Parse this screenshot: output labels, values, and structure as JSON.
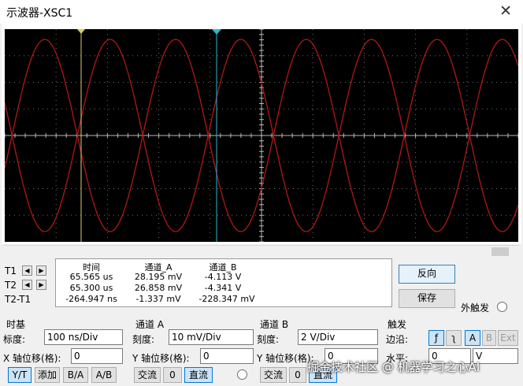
{
  "window": {
    "title": "示波器-XSC1",
    "close_glyph": "✕"
  },
  "cursors": {
    "labels": [
      "T1",
      "T2",
      "T2-T1"
    ],
    "arrow_left": "◆",
    "arrow_right": "◆"
  },
  "readout": {
    "headers": [
      "时间",
      "通道_A",
      "通道_B"
    ],
    "rows": [
      [
        "65.565 us",
        "28.195 mV",
        "-4.113 V"
      ],
      [
        "65.300 us",
        "26.858 mV",
        "-4.341 V"
      ],
      [
        "-264.947 ns",
        "-1.337 mV",
        "-228.347 mV"
      ]
    ]
  },
  "actions": {
    "reverse": "反向",
    "save": "保存",
    "ext_trigger": "外触发"
  },
  "timebase": {
    "title": "时基",
    "scale_label": "标度:",
    "scale_value": "100 ns/Div",
    "xpos_label": "X 轴位移(格):",
    "xpos_value": "0",
    "modes": [
      "Y/T",
      "添加",
      "B/A",
      "A/B"
    ]
  },
  "channel_a": {
    "title": "通道 A",
    "scale_label": "刻度:",
    "scale_value": "10 mV/Div",
    "ypos_label": "Y 轴位移(格):",
    "ypos_value": "0",
    "coupling": [
      "交流",
      "0",
      "直流"
    ]
  },
  "channel_b": {
    "title": "通道 B",
    "scale_label": "刻度:",
    "scale_value": "2  V/Div",
    "ypos_label": "Y 轴位移(格):",
    "ypos_value": "0",
    "coupling": [
      "交流",
      "0",
      "直流"
    ]
  },
  "trigger": {
    "title": "触发",
    "edge_label": "边沿:",
    "edge_rising": "ƒ",
    "edge_falling": "ʅ",
    "sources": [
      "A",
      "B",
      "Ext"
    ],
    "level_label": "水平:",
    "level_value": "0",
    "level_unit": "V"
  },
  "watermark": "掘金技术社区 @ 机器学习之心AI",
  "colors": {
    "screen_bg": "#000000",
    "grid": "#c8c8c8",
    "trace": "#b01818",
    "cursor_t1": "#d8d060",
    "cursor_t2": "#2fb8c8"
  }
}
